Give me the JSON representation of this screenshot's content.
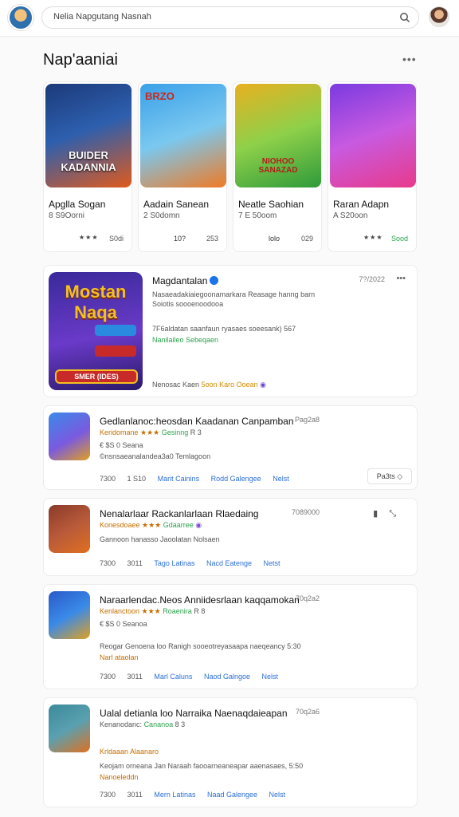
{
  "header": {
    "search_value": "Nelia Napgutang Nasnah"
  },
  "section": {
    "title": "Nap'aaniai",
    "more": "•••"
  },
  "cards": [
    {
      "art_text": "BUIDER\nKADANNIA",
      "title": "Apglla Sogan",
      "sub": "8 S9Oorni",
      "meta_l": "★★★",
      "meta_r": "S0di",
      "colors": [
        "#1c3a7a",
        "#e05a1c"
      ]
    },
    {
      "art_text": "BRZO",
      "title": "Aadain Sanean",
      "sub": "2 S0domn",
      "meta_l": "10?",
      "meta_r": "253",
      "colors": [
        "#3aa0e8",
        "#f07a24"
      ]
    },
    {
      "art_text": "NIOHOO\nSANAZAD",
      "title": "Neatle Saohian",
      "sub": "7 E 50oom",
      "meta_l": "lolo",
      "meta_r": "029",
      "colors": [
        "#e8b020",
        "#4cbf3a"
      ]
    },
    {
      "art_text": "",
      "title": "Raran Adapn",
      "sub": "A S20oon",
      "meta_l": "★★★",
      "meta_r": "Sood",
      "colors": [
        "#7a3ae0",
        "#e83a8a"
      ]
    }
  ],
  "feature": {
    "name": "Magdantalan",
    "date": "7?/2022",
    "more": "•••",
    "desc": "Nasaeadakiaiegoonamarkara Reasage hanng barn Soiotis soooenoodooa",
    "line2": "7F6aldatan saanfaun ryasaes soeesank) 567",
    "link": "Nanilaileo Sebeqaen",
    "foot_a": "Nenosac Kaen",
    "foot_b": "5oon",
    "foot_c": "Karo Ooean",
    "art_title": "Mostan Naqa",
    "art_btn1": "",
    "art_btn2": "SMER (IDES)"
  },
  "items": [
    {
      "title": "Gedlanlanoc:heosdan Kaadanan Canpamban",
      "date": "Pag2a8",
      "row1_a": "Keridomane ★★★",
      "row1_b": "Gesinng",
      "row1_c": "R 3",
      "row2": "€ $S 0 Seana",
      "row3": "©nsnsaeanalandea3a0 Temlagoon",
      "foot": [
        "7300",
        "1 S10",
        "Marit Cainins",
        "Rodd Galengee",
        "Nelst"
      ],
      "chip": "Pa3ts",
      "colors": [
        "#3a8ae8",
        "#e0a020"
      ]
    },
    {
      "title": "Nenalarlaar Rackanlarlaan Rlaedaing",
      "date": "7089000",
      "row1_a": "Konesdoaee ★★★",
      "row1_b": "Gdaarree",
      "row1_c": "",
      "row2": "Gannoon hanasso Jaoolatan Nolsaen",
      "row3": "",
      "foot": [
        "7300",
        "3011",
        "Tago Latinas",
        "Nacd Eatenge",
        "Netst"
      ],
      "chip": "",
      "colors": [
        "#8a3a2a",
        "#e07020"
      ]
    },
    {
      "title": "Naraarlendac.Neos Anniidesrlaan kaqqamokan",
      "date": "70q2a2",
      "row1_a": "Kenlanctoon ★★★",
      "row1_b": "Roaenira",
      "row1_c": "R 8",
      "row2": "€ $S 0 Seanoa",
      "row3": "Reogar Genoena loo Ranigh sooeotreyasaapa naeqeancy 5:30",
      "link": "Narl ataolan",
      "foot": [
        "7300",
        "3011",
        "Marl Caluns",
        "Naod Galngoe",
        "Nelst"
      ],
      "chip": "",
      "colors": [
        "#2a5ac8",
        "#e0a020"
      ]
    },
    {
      "title": "Ualal detianla loo Narraika Naenaqdaieapan",
      "date": "70q2a6",
      "row1_a": "Kenanodanc:",
      "row1_b": "Cananoa",
      "row1_c": "8 3",
      "row2": "Krldaaan Alaanaro",
      "row3": "Keojam orneana Jan Naraah faooarneaneapar aaenasaes, 5:50",
      "link": "Nanoeleddn",
      "foot": [
        "7300",
        "3011",
        "Mern Latinas",
        "Naad Galengee",
        "Nelst"
      ],
      "chip": "",
      "colors": [
        "#3a8a9a",
        "#e07020"
      ]
    }
  ]
}
